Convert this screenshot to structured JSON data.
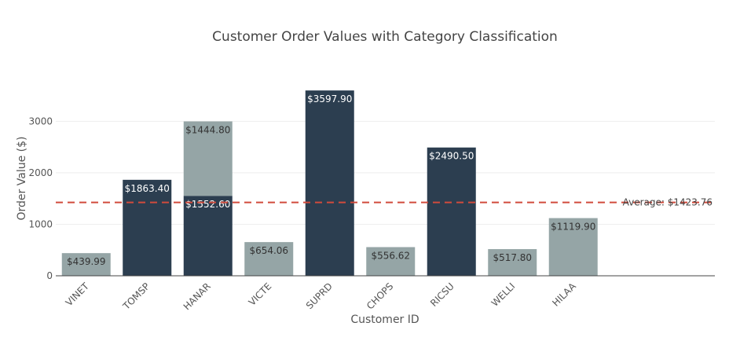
{
  "chart_data": {
    "type": "bar",
    "title": "Customer Order Values with Category Classification",
    "xlabel": "Customer ID",
    "ylabel": "Order Value ($)",
    "ylim": [
      0,
      3600
    ],
    "yticks": [
      0,
      1000,
      2000,
      3000
    ],
    "categories": [
      "VINET",
      "TOMSP",
      "HANAR",
      "VICTE",
      "SUPRD",
      "CHOPS",
      "RICSU",
      "WELLI",
      "HILAA"
    ],
    "bars": [
      {
        "customer": "VINET",
        "value": 439.99,
        "label": "$439.99",
        "category": "light",
        "stack": 0
      },
      {
        "customer": "TOMSP",
        "value": 1863.4,
        "label": "$1863.40",
        "category": "dark",
        "stack": 0
      },
      {
        "customer": "HANAR",
        "value": 1552.6,
        "label": "$1552.60",
        "category": "dark",
        "stack": 0
      },
      {
        "customer": "HANAR",
        "value": 1444.8,
        "label": "$1444.80",
        "category": "light",
        "stack": 1
      },
      {
        "customer": "VICTE",
        "value": 654.06,
        "label": "$654.06",
        "category": "light",
        "stack": 0
      },
      {
        "customer": "SUPRD",
        "value": 3597.9,
        "label": "$3597.90",
        "category": "dark",
        "stack": 0
      },
      {
        "customer": "CHOPS",
        "value": 556.62,
        "label": "$556.62",
        "category": "light",
        "stack": 0
      },
      {
        "customer": "RICSU",
        "value": 2490.5,
        "label": "$2490.50",
        "category": "dark",
        "stack": 0
      },
      {
        "customer": "WELLI",
        "value": 517.8,
        "label": "$517.80",
        "category": "light",
        "stack": 0
      },
      {
        "customer": "HILAA",
        "value": 1119.9,
        "label": "$1119.90",
        "category": "light",
        "stack": 0
      }
    ],
    "average": {
      "value": 1423.76,
      "label": "Average: $1423.76"
    },
    "grid": true,
    "legend": "none",
    "colors": {
      "dark": "#2c3e50",
      "light": "#95a5a6",
      "average_line": "#d14b3c",
      "grid": "#eeeeee",
      "axis": "#444444"
    }
  }
}
